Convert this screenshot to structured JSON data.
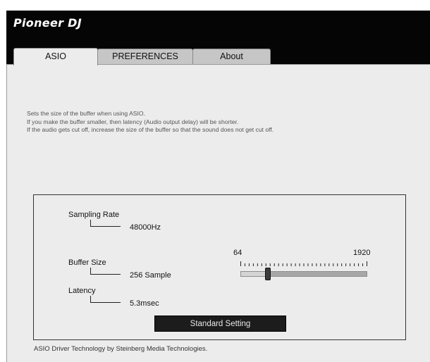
{
  "header": {
    "brand": "Pioneer DJ"
  },
  "tabs": [
    {
      "label": "ASIO",
      "active": true
    },
    {
      "label": "PREFERENCES",
      "active": false
    },
    {
      "label": "About",
      "active": false
    }
  ],
  "description": {
    "line1": "Sets the size of the buffer when using ASIO.",
    "line2": "If you make the buffer smaller, then latency (Audio output delay) will be shorter.",
    "line3": "If the audio gets cut off, increase the size of the buffer so that the sound does not get cut off."
  },
  "settings": {
    "sampling_rate": {
      "label": "Sampling Rate",
      "value": "48000Hz"
    },
    "buffer_size": {
      "label": "Buffer Size",
      "value": "256 Sample"
    },
    "latency": {
      "label": "Latency",
      "value": "5.3msec"
    },
    "slider": {
      "min_label": "64",
      "max_label": "1920",
      "min": 64,
      "max": 1920,
      "value": 256
    },
    "standard_button": "Standard Setting"
  },
  "footer": "ASIO Driver Technology by Steinberg Media Technologies.",
  "colors": {
    "titlebar": "#050505",
    "panel": "#ececec",
    "button": "#1c1c1c"
  }
}
